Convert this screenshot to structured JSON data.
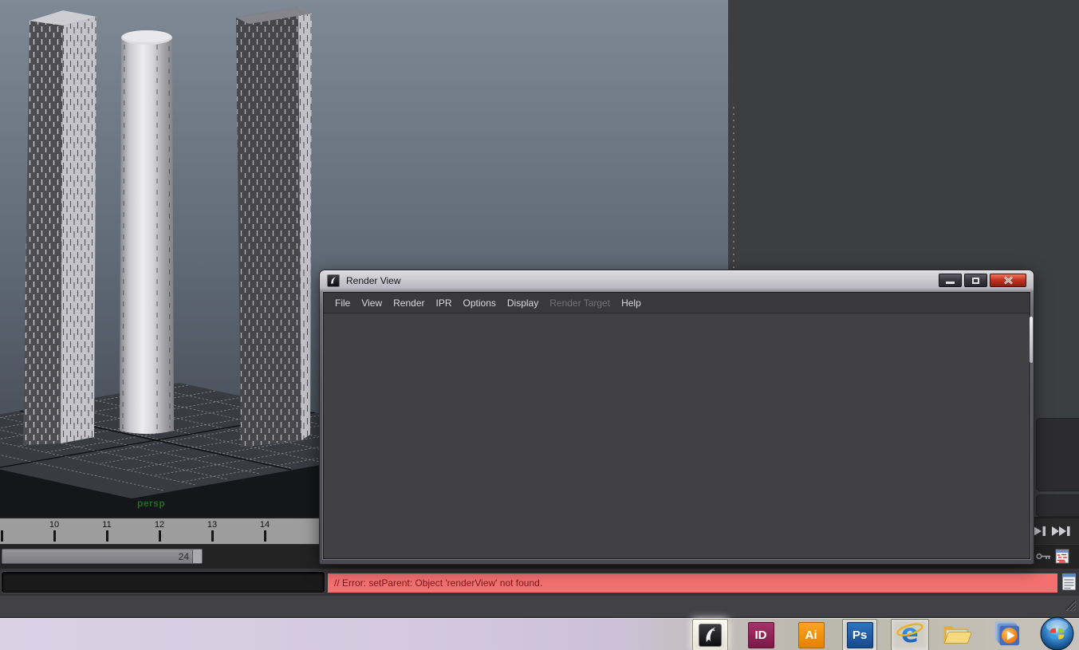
{
  "viewport": {
    "camera_label": "persp"
  },
  "render_view": {
    "title": "Render View",
    "menus": [
      {
        "label": "File",
        "enabled": true
      },
      {
        "label": "View",
        "enabled": true
      },
      {
        "label": "Render",
        "enabled": true
      },
      {
        "label": "IPR",
        "enabled": true
      },
      {
        "label": "Options",
        "enabled": true
      },
      {
        "label": "Display",
        "enabled": true
      },
      {
        "label": "Render Target",
        "enabled": false
      },
      {
        "label": "Help",
        "enabled": true
      }
    ],
    "window_controls": [
      "minimize",
      "maximize",
      "close"
    ]
  },
  "timeline": {
    "tick_labels": [
      "10",
      "11",
      "12",
      "13",
      "14"
    ],
    "range_end_value": "24"
  },
  "command_line": {
    "error_message": "// Error: setParent: Object 'renderView' not found."
  },
  "taskbar": {
    "indesign_label": "ID",
    "illustrator_label": "Ai",
    "photoshop_label": "Ps",
    "ie_label": "e"
  },
  "colors": {
    "error_bg": "#f47070",
    "error_text": "#7c1818",
    "viewport_label_green": "#1d6e1d",
    "close_button_red": "#c23423",
    "taskbar_lavender": "#d5c8de"
  }
}
